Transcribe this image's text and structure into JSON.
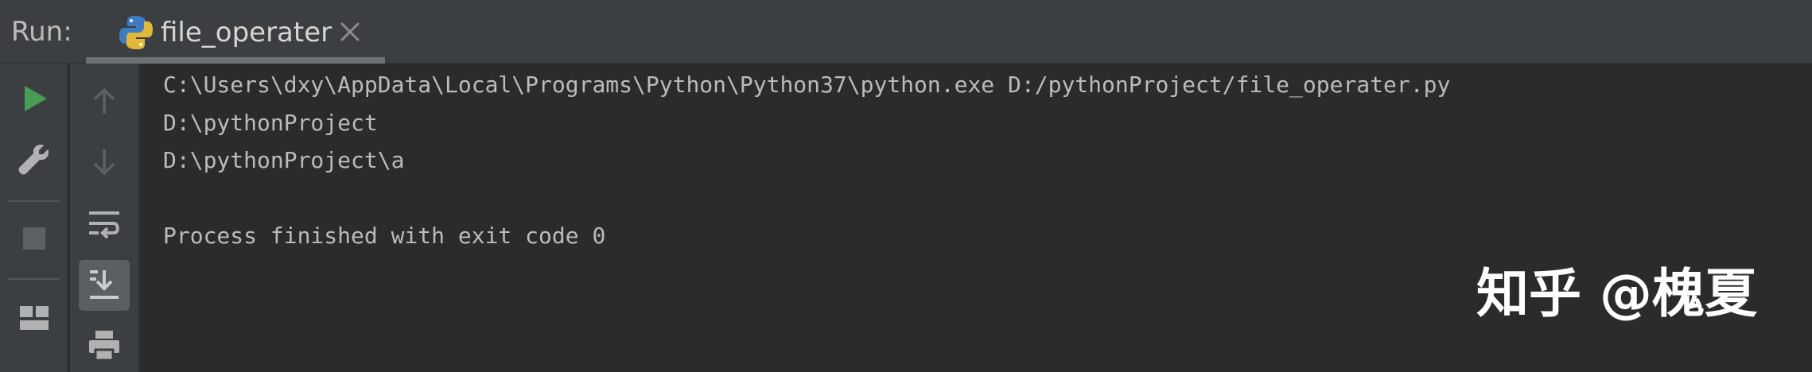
{
  "run_panel": {
    "label": "Run:",
    "tab": {
      "label": "file_operater",
      "icon": "python-icon",
      "close_icon": "close-icon"
    }
  },
  "toolbar_left": [
    {
      "name": "run-button",
      "icon": "play-icon",
      "color": "#499c54"
    },
    {
      "name": "edit-configuration-button",
      "icon": "wrench-icon"
    },
    {
      "name": "stop-button",
      "icon": "stop-icon"
    },
    {
      "name": "restore-layout-button",
      "icon": "layout-icon"
    }
  ],
  "toolbar_right": [
    {
      "name": "up-button",
      "icon": "arrow-up-icon"
    },
    {
      "name": "down-button",
      "icon": "arrow-down-icon"
    },
    {
      "name": "soft-wrap-button",
      "icon": "soft-wrap-icon"
    },
    {
      "name": "scroll-to-end-button",
      "icon": "scroll-to-end-icon",
      "active": true
    },
    {
      "name": "print-button",
      "icon": "print-icon"
    }
  ],
  "console": {
    "lines": [
      "C:\\Users\\dxy\\AppData\\Local\\Programs\\Python\\Python37\\python.exe D:/pythonProject/file_operater.py",
      "D:\\pythonProject",
      "D:\\pythonProject\\a",
      "",
      "Process finished with exit code 0"
    ]
  },
  "watermark": "知乎 @槐夏"
}
